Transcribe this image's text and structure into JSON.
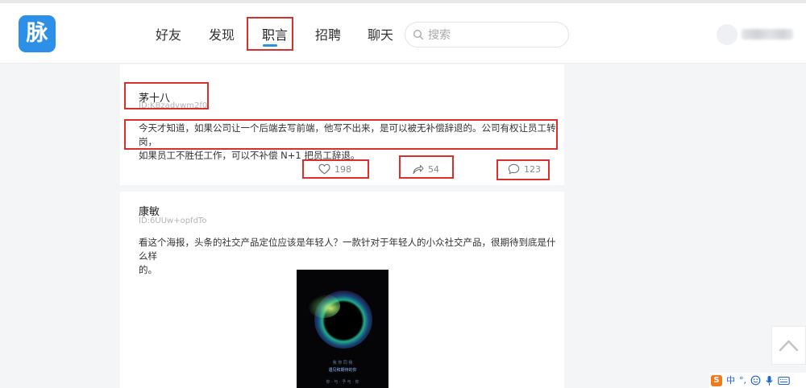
{
  "app": {
    "logo_char": "脉",
    "brand_color": "#2c8fe8",
    "highlight_color": "#d9302c"
  },
  "nav": {
    "items": [
      {
        "label": "好友"
      },
      {
        "label": "发现"
      },
      {
        "label": "职言",
        "active": true
      },
      {
        "label": "招聘"
      },
      {
        "label": "聊天"
      }
    ]
  },
  "search": {
    "placeholder": "搜索",
    "icon": "search-icon"
  },
  "user": {
    "avatar_icon": "avatar",
    "name_blurred": true
  },
  "posts": [
    {
      "author": "茅十八",
      "id": "ID:KBzadvwm2f0",
      "text_lines": [
        "今天才知道，如果公司让一个后端去写前端，他写不出来，是可以被无补偿辞退的。公司有权让员工转岗，",
        "如果员工不胜任工作，可以不补偿 N+1 把员工辞退。"
      ],
      "likes": "198",
      "shares": "54",
      "comments": "123"
    },
    {
      "author": "康敏",
      "id": "ID:6UUw+opfdTo",
      "text_lines": [
        "看这个海报，头条的社交产品定位应该是年轻人？一款针对于年轻人的小众社交产品，很期待到底是什么样",
        "的。"
      ],
      "poster_lines": [
        "我   你   同 我",
        "遇见和期待的你",
        "你 · 与 · 予 与 · 你"
      ]
    }
  ],
  "ime": {
    "logo": "S",
    "lang": "中",
    "punct": "°,",
    "icons": [
      "smiley-icon",
      "microphone-icon",
      "keyboard-icon"
    ]
  }
}
